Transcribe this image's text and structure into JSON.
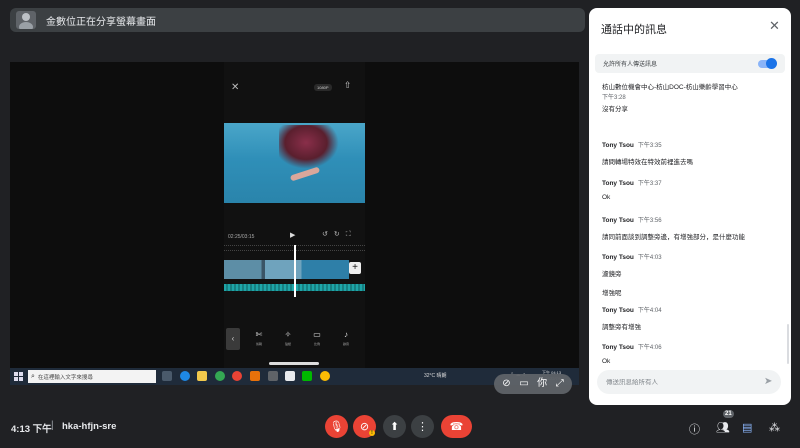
{
  "banner": {
    "text": "金數位正在分享螢幕畫面"
  },
  "shared_screen": {
    "phone": {
      "resolution": "1080P",
      "time": "02:25/03:15",
      "toolbar": [
        {
          "icon": "scissors-icon",
          "glyph": "✄",
          "label": "剪輯"
        },
        {
          "icon": "sticker-icon",
          "glyph": "✧",
          "label": "貼紙"
        },
        {
          "icon": "folder-icon",
          "glyph": "▭",
          "label": "比例"
        },
        {
          "icon": "mic-icon",
          "glyph": "♪",
          "label": "錄音"
        }
      ]
    },
    "taskbar": {
      "search_placeholder": "在這裡輸入文字來搜尋",
      "weather": "32°C 晴朗",
      "clock_time": "下午 04:13",
      "clock_date": "2022/7/9"
    }
  },
  "chat": {
    "title": "通話中的訊息",
    "allow_label": "允許所有人傳送訊息",
    "allow_enabled": true,
    "messages": [
      {
        "org": "枋山數位機會中心-枋山DOC-枋山樂齡學習中心",
        "time": "下午3:28",
        "body": "沒有分享"
      },
      {
        "sender": "Tony Tsou",
        "time": "下午3:35",
        "body": "請問轉場特效在特效前裡進去嗎"
      },
      {
        "sender": "Tony Tsou",
        "time": "下午3:37",
        "body": "Ok"
      },
      {
        "sender": "Tony Tsou",
        "time": "下午3:56",
        "body": "請同前面談到調整旁邊，有增強部分，是什麼功能"
      },
      {
        "sender": "Tony Tsou",
        "time": "下午4:03",
        "body": "濾鏡旁",
        "body2": "增強呢"
      },
      {
        "sender": "Tony Tsou",
        "time": "下午4:04",
        "body": "調整旁有增強"
      },
      {
        "sender": "Tony Tsou",
        "time": "下午4:06",
        "body": "Ok"
      }
    ],
    "input_placeholder": "傳送訊息給所有人"
  },
  "pill": {
    "you_label": "你"
  },
  "bottom": {
    "time": "4:13 下午",
    "separator": "|",
    "meeting_code": "hka-hfjn-sre",
    "participant_count": "21"
  },
  "colors": {
    "danger": "#ea4335",
    "accent": "#8ab4f8",
    "panel": "#ffffff",
    "background": "#202124"
  }
}
